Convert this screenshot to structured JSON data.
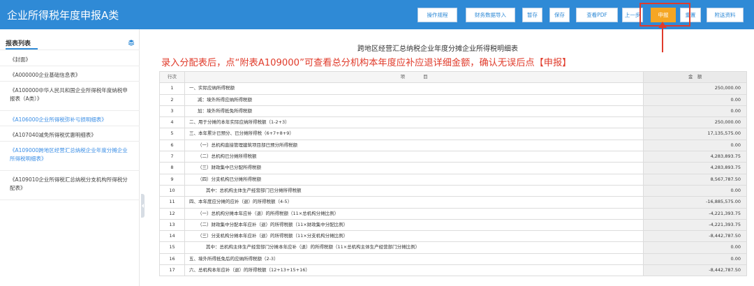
{
  "app": {
    "title": "企业所得税年度申报A类"
  },
  "toolbar": {
    "buttons": [
      {
        "label": "操作规程"
      },
      {
        "label": "财务数据导入"
      },
      {
        "label": "暂存"
      },
      {
        "label": "保存"
      },
      {
        "label": "查看PDF"
      },
      {
        "label": "上一步"
      },
      {
        "label": "申报",
        "active": true
      },
      {
        "label": "重置"
      },
      {
        "label": "附送资料"
      }
    ],
    "accent_color": "#f5a623"
  },
  "theme": {
    "brand": "#2f8ad6",
    "annotation": "#e03b2b"
  },
  "sidebar": {
    "title": "报表列表",
    "icon": "layers-icon",
    "items": [
      {
        "label": "《封面》"
      },
      {
        "label": "《A000000企业基础信息表》"
      },
      {
        "label": "《A100000中华人民共和国企业所得税年度纳税申报表（A类）》"
      },
      {
        "label": "《A106000企业所得税弥补亏损明细表》",
        "active": true
      },
      {
        "label": "《A107040减免所得税优惠明细表》"
      },
      {
        "label": "《A109000跨地区经营汇总纳税企业年度分摊企业所得税明细表》",
        "active": true
      },
      {
        "label": "《A109010企业所得税汇总纳税分支机构所得税分配表》"
      }
    ]
  },
  "form": {
    "title": "跨地区经营汇总纳税企业年度分摊企业所得税明细表",
    "notice": "录入分配表后，点“附表A109000”可查看总分机构本年度应补应退详细金额，确认无误后点【申报】",
    "headers": {
      "no": "行次",
      "item": "项　　　　目",
      "amount": "金　额"
    },
    "rows": [
      {
        "no": "1",
        "item": "一、实际应纳所得税额",
        "amount": "250,000.00",
        "indent": 0
      },
      {
        "no": "2",
        "item": "减：境外所得应纳所得税额",
        "amount": "0.00",
        "indent": 1
      },
      {
        "no": "3",
        "item": "加：境外所得抵免所得税额",
        "amount": "0.00",
        "indent": 1
      },
      {
        "no": "4",
        "item": "二、用于分摊的本年实际应纳所得税额（1-2+3）",
        "amount": "250,000.00",
        "indent": 0
      },
      {
        "no": "5",
        "item": "三、本年累计已预分、已分摊所得税（6+7+8+9）",
        "amount": "17,135,575.00",
        "indent": 0
      },
      {
        "no": "6",
        "item": "（一）总机构直接管理建筑项目部已预分所得税额",
        "amount": "0.00",
        "indent": 1
      },
      {
        "no": "7",
        "item": "（二）总机构已分摊所得税额",
        "amount": "4,283,893.75",
        "indent": 1
      },
      {
        "no": "8",
        "item": "（三）财政集中已分配所得税额",
        "amount": "4,283,893.75",
        "indent": 1
      },
      {
        "no": "9",
        "item": "（四）分支机构已分摊所得税额",
        "amount": "8,567,787.50",
        "indent": 1
      },
      {
        "no": "10",
        "item": "其中：总机构主体生产经营部门已分摊所得税额",
        "amount": "0.00",
        "indent": 2
      },
      {
        "no": "11",
        "item": "四、本年度应分摊的应补（退）的所得税额（4-5）",
        "amount": "-16,885,575.00",
        "indent": 0
      },
      {
        "no": "12",
        "item": "（一）总机构分摊本年应补（退）的所得税额（11×总机构分摊比例）",
        "amount": "-4,221,393.75",
        "indent": 1
      },
      {
        "no": "13",
        "item": "（二）财政集中分配本年应补（退）的所得税额（11×财政集中分配比例）",
        "amount": "-4,221,393.75",
        "indent": 1
      },
      {
        "no": "14",
        "item": "（三）分支机构分摊本年应补（退）的所得税额（11×分支机构分摊比例）",
        "amount": "-8,442,787.50",
        "indent": 1
      },
      {
        "no": "15",
        "item": "其中：总机构主体生产经营部门分摊本年应补（退）的所得税额（11×总机构主体生产经营部门分摊比例）",
        "amount": "0.00",
        "indent": 2
      },
      {
        "no": "16",
        "item": "五、境外所得抵免后的应纳所得税额（2-3）",
        "amount": "0.00",
        "indent": 0
      },
      {
        "no": "17",
        "item": "六、总机构本年应补（退）的所得税额（12+13+15+16）",
        "amount": "-8,442,787.50",
        "indent": 0
      }
    ]
  }
}
